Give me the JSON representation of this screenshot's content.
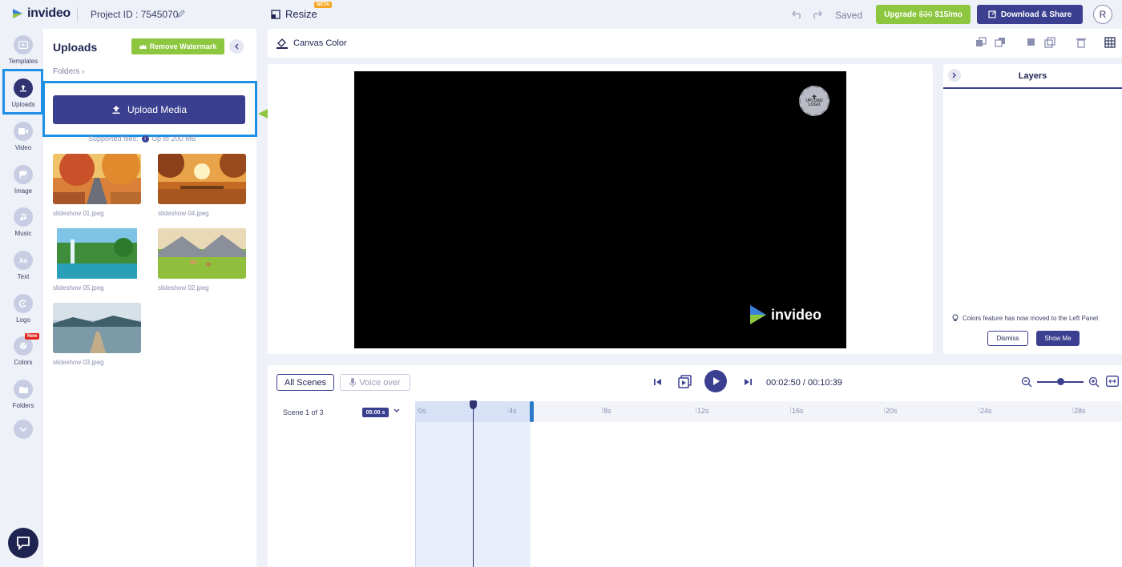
{
  "header": {
    "brand": "invideo",
    "project_id": "Project ID : 7545070",
    "resize": "Resize",
    "beta": "BETA",
    "saved": "Saved",
    "upgrade_label": "Upgrade",
    "upgrade_old_price": "$30",
    "upgrade_price": "$15/mo",
    "download": "Download & Share",
    "avatar": "R"
  },
  "leftnav": {
    "items": [
      {
        "label": "Templates",
        "icon": "templates-icon"
      },
      {
        "label": "Uploads",
        "icon": "upload-icon"
      },
      {
        "label": "Video",
        "icon": "video-icon"
      },
      {
        "label": "Image",
        "icon": "image-icon"
      },
      {
        "label": "Music",
        "icon": "music-icon"
      },
      {
        "label": "Text",
        "icon": "text-icon"
      },
      {
        "label": "Logo",
        "icon": "logo-icon"
      },
      {
        "label": "Colors",
        "icon": "colors-icon"
      },
      {
        "label": "Folders",
        "icon": "folder-icon"
      }
    ],
    "new_badge": "New"
  },
  "panel": {
    "title": "Uploads",
    "remove_watermark": "Remove Watermark",
    "folders": "Folders",
    "upload_button": "Upload Media",
    "supported_prefix": "Supported files:",
    "supported_suffix": "Up to 200 MB",
    "files": [
      {
        "name": "slideshow 01.jpeg"
      },
      {
        "name": "slideshow 04.jpeg"
      },
      {
        "name": "slideshow 05.jpeg"
      },
      {
        "name": "slideshow 02.jpeg"
      },
      {
        "name": "slideshow 03.jpeg"
      }
    ]
  },
  "canvas": {
    "canvas_color": "Canvas Color",
    "upload_logo_line1": "UPLOAD",
    "upload_logo_line2": "LOGO",
    "watermark": "invideo"
  },
  "layers": {
    "title": "Layers",
    "notice": "Colors feature has now moved to the Left Panel",
    "dismiss": "Dismiss",
    "show_me": "Show Me"
  },
  "timeline": {
    "all_scenes": "All Scenes",
    "voice_over": "Voice over",
    "current_time": "00:02:50",
    "separator": "/",
    "total_time": "00:10:39",
    "scene_label": "Scene 1 of 3",
    "scene_duration": "05:00 s",
    "ticks": [
      "0s",
      "4s",
      "8s",
      "12s",
      "16s",
      "20s",
      "24s",
      "28s"
    ],
    "playhead_seconds": 2.5
  },
  "colors": {
    "brand": "#3b3f8f",
    "accent_green": "#8dc63f",
    "highlight_blue": "#1e90e6"
  }
}
